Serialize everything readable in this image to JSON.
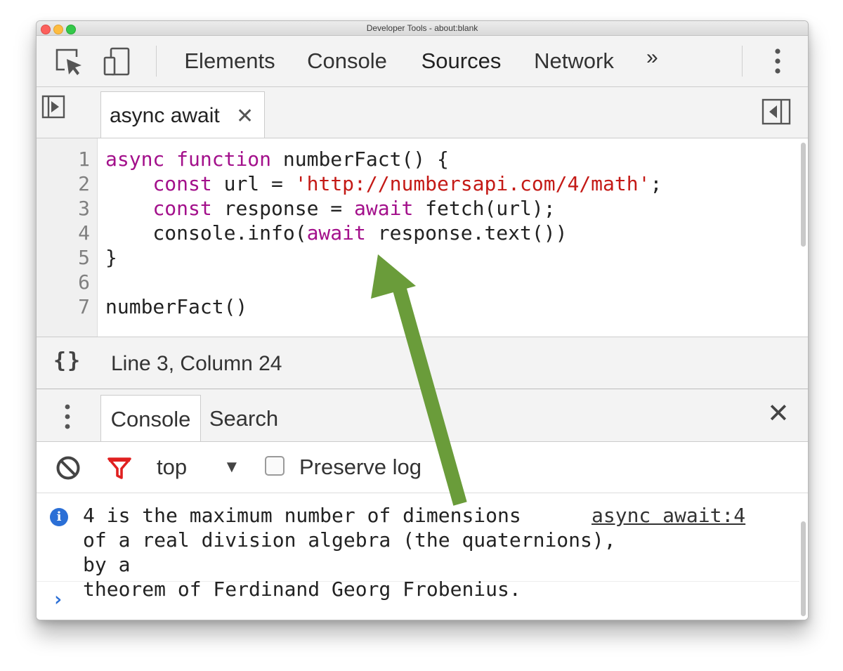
{
  "window": {
    "title": "Developer Tools - about:blank"
  },
  "toolbar": {
    "tabs": [
      {
        "label": "Elements",
        "active": false
      },
      {
        "label": "Console",
        "active": false
      },
      {
        "label": "Sources",
        "active": true
      },
      {
        "label": "Network",
        "active": false
      }
    ],
    "more_tabs": "»",
    "icons": [
      "inspect-element-icon",
      "device-toolbar-icon",
      "more-options-icon"
    ],
    "accent_color": "#3f7ff2"
  },
  "file_bar": {
    "open_file": "async await",
    "close_glyph": "✕"
  },
  "editor": {
    "line_numbers": [
      "1",
      "2",
      "3",
      "4",
      "5",
      "6",
      "7"
    ],
    "lines": [
      {
        "tokens": [
          {
            "t": "async",
            "c": "kw"
          },
          {
            "t": " "
          },
          {
            "t": "function",
            "c": "kw"
          },
          {
            "t": " numberFact() {"
          }
        ]
      },
      {
        "tokens": [
          {
            "t": "    "
          },
          {
            "t": "const",
            "c": "kw"
          },
          {
            "t": " url = "
          },
          {
            "t": "'http://numbersapi.com/4/math'",
            "c": "str"
          },
          {
            "t": ";"
          }
        ]
      },
      {
        "tokens": [
          {
            "t": "    "
          },
          {
            "t": "const",
            "c": "kw"
          },
          {
            "t": " response = "
          },
          {
            "t": "await",
            "c": "kw"
          },
          {
            "t": " fetch(url);"
          }
        ]
      },
      {
        "tokens": [
          {
            "t": "    console.info("
          },
          {
            "t": "await",
            "c": "kw"
          },
          {
            "t": " response.text())"
          }
        ]
      },
      {
        "tokens": [
          {
            "t": "}"
          }
        ]
      },
      {
        "tokens": [
          {
            "t": ""
          }
        ]
      },
      {
        "tokens": [
          {
            "t": "numberFact()"
          }
        ]
      }
    ],
    "keyword_color": "#a3108b",
    "string_color": "#c41a16"
  },
  "status_bar": {
    "pretty_print_glyph": "{}",
    "cursor_position": "Line 3, Column 24"
  },
  "drawer": {
    "tabs": [
      {
        "label": "Console",
        "active": true
      },
      {
        "label": "Search",
        "active": false
      }
    ],
    "close_glyph": "✕"
  },
  "console_toolbar": {
    "context": "top",
    "context_arrow": "▼",
    "preserve_log_label": "Preserve log",
    "preserve_log_checked": false,
    "filter_color": "#e02020"
  },
  "console": {
    "message": "4 is the maximum number of dimensions\nof a real division algebra (the quaternions), by a\ntheorem of Ferdinand Georg Frobenius.",
    "source": "async await:4",
    "info_glyph": "i",
    "prompt_glyph": "›"
  },
  "annotation": {
    "arrow_color": "#6a9c3a"
  }
}
